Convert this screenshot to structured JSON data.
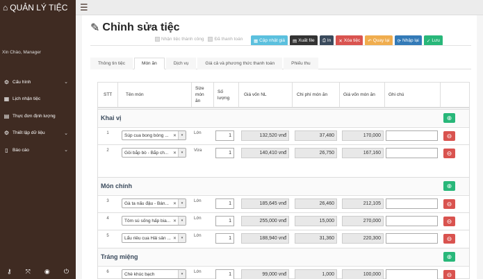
{
  "sidebar": {
    "brand": "QUẢN LÝ TIỆC",
    "brand_icon": "home-icon",
    "greeting": "Xin Chào, Manager",
    "items": [
      {
        "label": "Cấu hình",
        "icon": "gear-icon",
        "has_chevron": true
      },
      {
        "label": "Lịch nhận tiệc",
        "icon": "calendar-icon",
        "has_chevron": false
      },
      {
        "label": "Thực đơn định lượng",
        "icon": "book-icon",
        "has_chevron": false
      },
      {
        "label": "Thiết lập dữ liệu",
        "icon": "cogs-icon",
        "has_chevron": true
      },
      {
        "label": "Báo cáo",
        "icon": "file-icon",
        "has_chevron": true
      }
    ],
    "bottom_icons": [
      "key-icon",
      "fullscreen-icon",
      "eye-slash-icon",
      "power-icon"
    ]
  },
  "page": {
    "title": "Chỉnh sửa tiệc",
    "title_icon": "edit-icon"
  },
  "checkboxes": [
    {
      "label": "Nhận tiệc thành công",
      "checked": false
    },
    {
      "label": "Đã thanh toán",
      "checked": false
    }
  ],
  "actions": [
    {
      "label": "Cập nhật giá",
      "icon": "calculator-icon",
      "color": "#5bc0de"
    },
    {
      "label": "Xuất file",
      "icon": "file-export-icon",
      "color": "#333333"
    },
    {
      "label": "In",
      "icon": "print-icon",
      "color": "#3a4a5c"
    },
    {
      "label": "Xóa tiệc",
      "icon": "close-icon",
      "color": "#d9534f"
    },
    {
      "label": "Quay lại",
      "icon": "undo-icon",
      "color": "#f0ad4e"
    },
    {
      "label": "Nhập lại",
      "icon": "refresh-icon",
      "color": "#337ab7"
    },
    {
      "label": "Lưu",
      "icon": "check-icon",
      "color": "#28b779"
    }
  ],
  "tabs": [
    {
      "label": "Thông tin tiệc",
      "active": false
    },
    {
      "label": "Món ăn",
      "active": true
    },
    {
      "label": "Dịch vụ",
      "active": false
    },
    {
      "label": "Giá cả và phương thức thanh toán",
      "active": false
    },
    {
      "label": "Phiếu thu",
      "active": false
    }
  ],
  "table": {
    "columns": [
      "STT",
      "Tên món",
      "Size món ăn",
      "Số lượng",
      "Giá vốn NL",
      "Chi phí món ăn",
      "Giá vốn món ăn",
      "Ghi chú"
    ],
    "groups": [
      {
        "name": "Khai vị",
        "items": [
          {
            "stt": "1",
            "dish": "Súp cua bong bóng ...",
            "size": "Lớn",
            "qty": "1",
            "cost": "132,520 vnđ",
            "fee": "37,480",
            "total": "170,000",
            "note": ""
          },
          {
            "stt": "2",
            "dish": "Gỏi bắp bò - Bắp ch...",
            "size": "Vừa",
            "qty": "1",
            "cost": "140,410 vnđ",
            "fee": "26,750",
            "total": "167,160",
            "note": ""
          }
        ]
      },
      {
        "name": "Món chính",
        "items": [
          {
            "stt": "3",
            "dish": "Gà ta nấu đậu - Bán...",
            "size": "Lớn",
            "qty": "1",
            "cost": "185,645 vnđ",
            "fee": "26,460",
            "total": "212,105",
            "note": ""
          },
          {
            "stt": "4",
            "dish": "Tôm sú sống hấp bia...",
            "size": "Lớn",
            "qty": "1",
            "cost": "255,000 vnđ",
            "fee": "15,000",
            "total": "270,000",
            "note": ""
          },
          {
            "stt": "5",
            "dish": "Lẩu riêu cua Hải sản ...",
            "size": "Lớn",
            "qty": "1",
            "cost": "188,940 vnđ",
            "fee": "31,360",
            "total": "220,300",
            "note": ""
          }
        ]
      },
      {
        "name": "Tráng miệng",
        "items": [
          {
            "stt": "6",
            "dish": "Chè khúc bạch",
            "size": "Lớn",
            "qty": "1",
            "cost": "99,000 vnđ",
            "fee": "1,000",
            "total": "100,000",
            "note": ""
          }
        ]
      }
    ]
  }
}
